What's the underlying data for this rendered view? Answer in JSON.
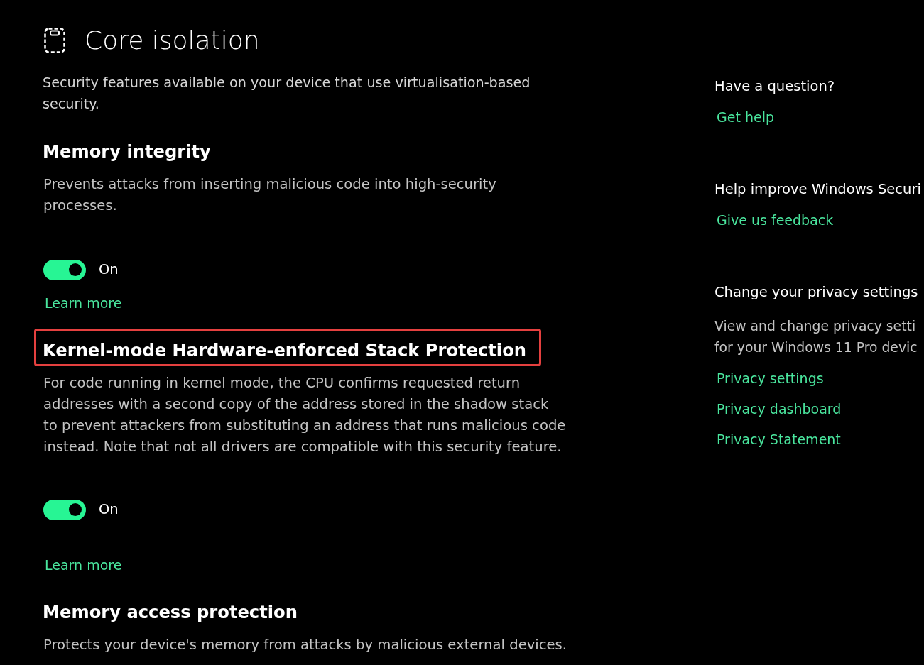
{
  "page": {
    "title": "Core isolation",
    "description": "Security features available on your device that use virtualisation-based\nsecurity."
  },
  "sections": [
    {
      "heading": "Memory integrity",
      "highlighted": false,
      "description": "Prevents attacks from inserting malicious code into high-security\nprocesses.",
      "toggle": {
        "on": true,
        "label": "On"
      },
      "link": "Learn more"
    },
    {
      "heading": "Kernel-mode Hardware-enforced Stack Protection",
      "highlighted": true,
      "description": "For code running in kernel mode, the CPU confirms requested return\naddresses with a second copy of the address stored in the shadow stack\nto prevent attackers from substituting an address that runs malicious code\ninstead. Note that not all drivers are compatible with this security feature.",
      "toggle": {
        "on": true,
        "label": "On"
      },
      "link": "Learn more"
    },
    {
      "heading": "Memory access protection",
      "highlighted": false,
      "description": "Protects your device's memory from attacks by malicious external devices."
    }
  ],
  "sidebar": [
    {
      "heading": "Have a question?",
      "links": [
        "Get help"
      ]
    },
    {
      "heading": "Help improve Windows Securi",
      "links": [
        "Give us feedback"
      ]
    },
    {
      "heading": "Change your privacy settings",
      "description": "View and change privacy setti\nfor your Windows 11 Pro devic",
      "links": [
        "Privacy settings",
        "Privacy dashboard",
        "Privacy Statement"
      ]
    }
  ]
}
